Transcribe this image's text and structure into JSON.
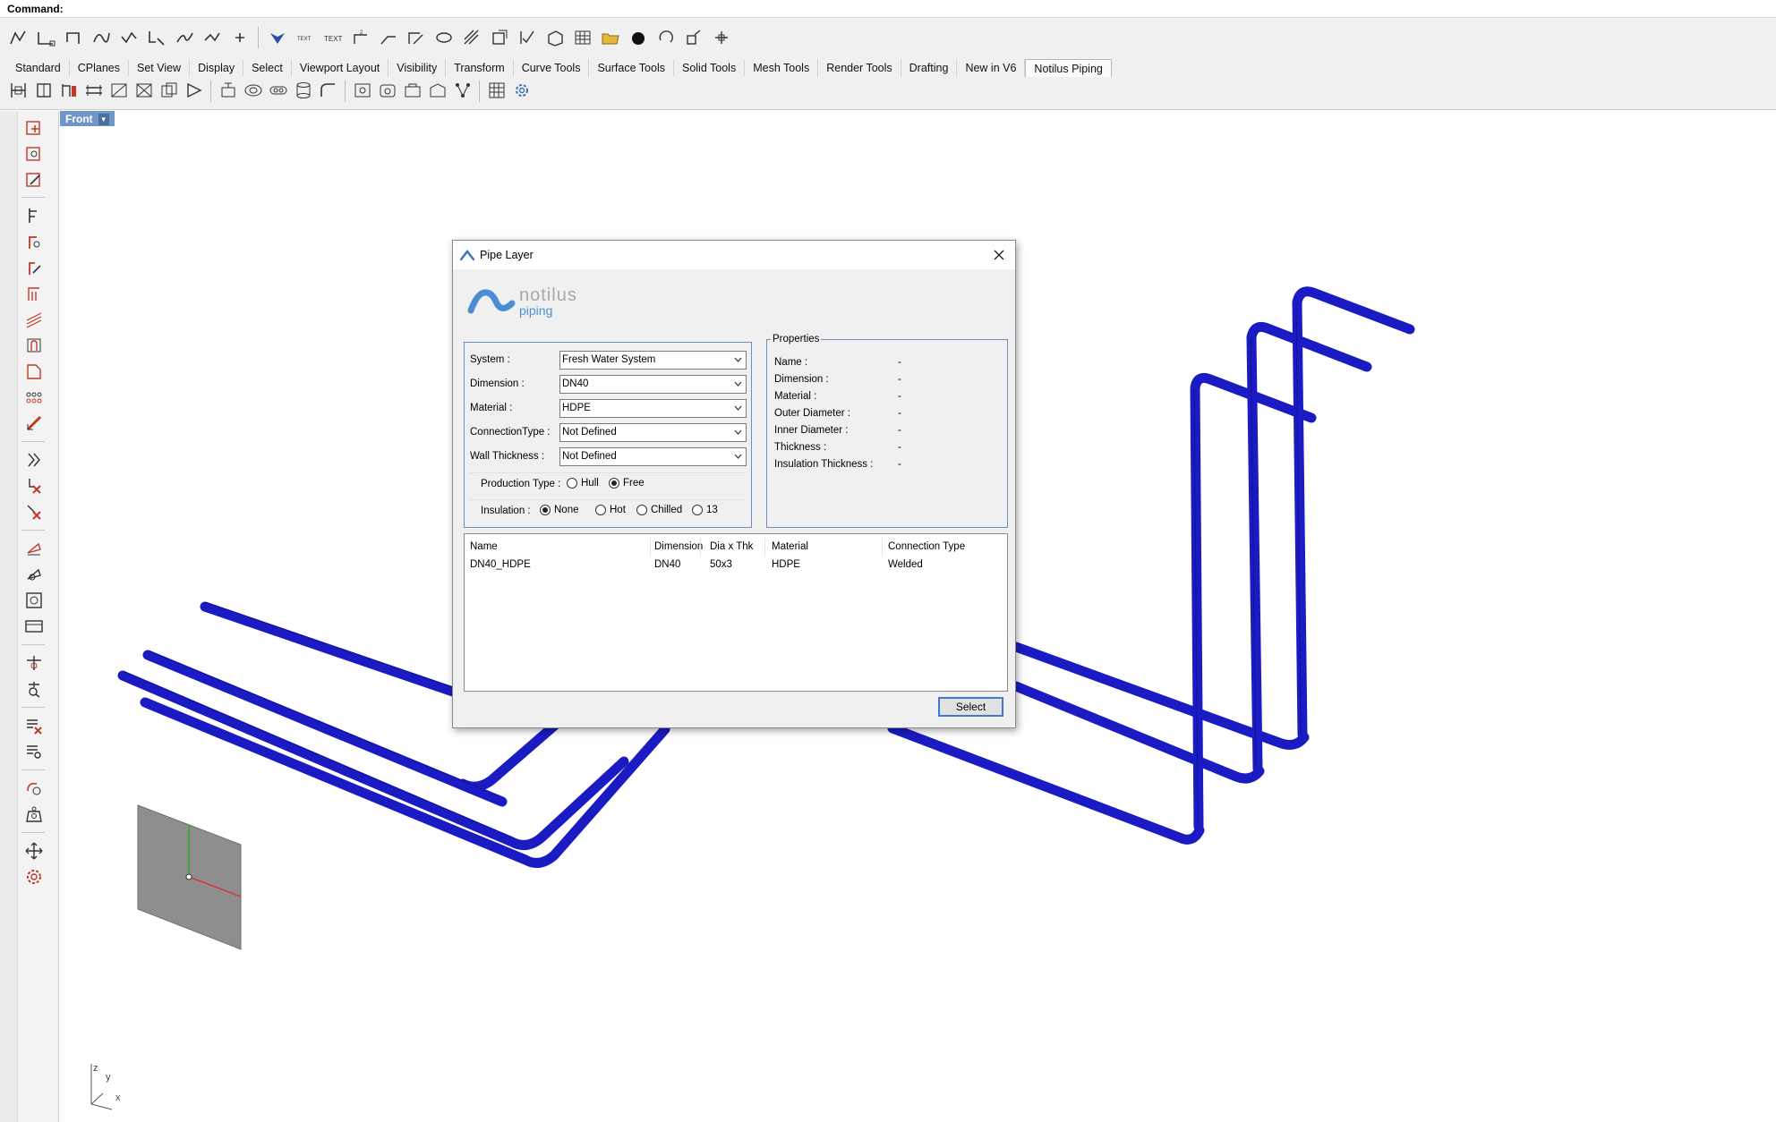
{
  "command_line": {
    "label": "Command:",
    "value": ""
  },
  "tabs": [
    {
      "label": "Standard"
    },
    {
      "label": "CPlanes"
    },
    {
      "label": "Set View"
    },
    {
      "label": "Display"
    },
    {
      "label": "Select"
    },
    {
      "label": "Viewport Layout"
    },
    {
      "label": "Visibility"
    },
    {
      "label": "Transform"
    },
    {
      "label": "Curve Tools"
    },
    {
      "label": "Surface Tools"
    },
    {
      "label": "Solid Tools"
    },
    {
      "label": "Mesh Tools"
    },
    {
      "label": "Render Tools"
    },
    {
      "label": "Drafting"
    },
    {
      "label": "New in V6"
    },
    {
      "label": "Notilus Piping"
    }
  ],
  "active_tab": "Notilus Piping",
  "viewport": {
    "name": "Front"
  },
  "axis_labels": {
    "z": "z",
    "y": "y",
    "x": "x"
  },
  "colors": {
    "pipe": "#1414c8",
    "pipe_dark": "#0a0a8a",
    "accent": "#3d7bd1",
    "viewport_tab": "#6f96c6"
  },
  "dialog": {
    "title": "Pipe Layer",
    "close_icon": "close-icon",
    "logo": {
      "line1": "notilus",
      "line2": "piping"
    },
    "fields": {
      "system": {
        "label": "System :",
        "value": "Fresh Water System"
      },
      "dimension": {
        "label": "Dimension :",
        "value": "DN40"
      },
      "material": {
        "label": "Material :",
        "value": "HDPE"
      },
      "connection_type": {
        "label": "ConnectionType :",
        "value": "Not Defined"
      },
      "wall_thickness": {
        "label": "Wall Thickness :",
        "value": "Not Defined"
      }
    },
    "production_type": {
      "label": "Production Type :",
      "options": [
        "Hull",
        "Free"
      ],
      "selected": "Free"
    },
    "insulation": {
      "label": "Insulation :",
      "options": [
        "None",
        "Hot",
        "Chilled",
        "13"
      ],
      "selected": "None"
    },
    "properties": {
      "legend": "Properties",
      "rows": [
        {
          "key": "Name :",
          "value": "-"
        },
        {
          "key": "Dimension :",
          "value": "-"
        },
        {
          "key": "Material :",
          "value": "-"
        },
        {
          "key": "Outer Diameter :",
          "value": "-"
        },
        {
          "key": "Inner Diameter :",
          "value": "-"
        },
        {
          "key": "Thickness :",
          "value": "-"
        },
        {
          "key": "Insulation Thickness :",
          "value": "-"
        }
      ]
    },
    "table": {
      "columns": [
        "Name",
        "Dimension",
        "Dia x Thk",
        "Material",
        "Connection Type"
      ],
      "rows": [
        [
          "DN40_HDPE",
          "DN40",
          "50x3",
          "HDPE",
          "Welded"
        ]
      ]
    },
    "select_button": "Select"
  }
}
